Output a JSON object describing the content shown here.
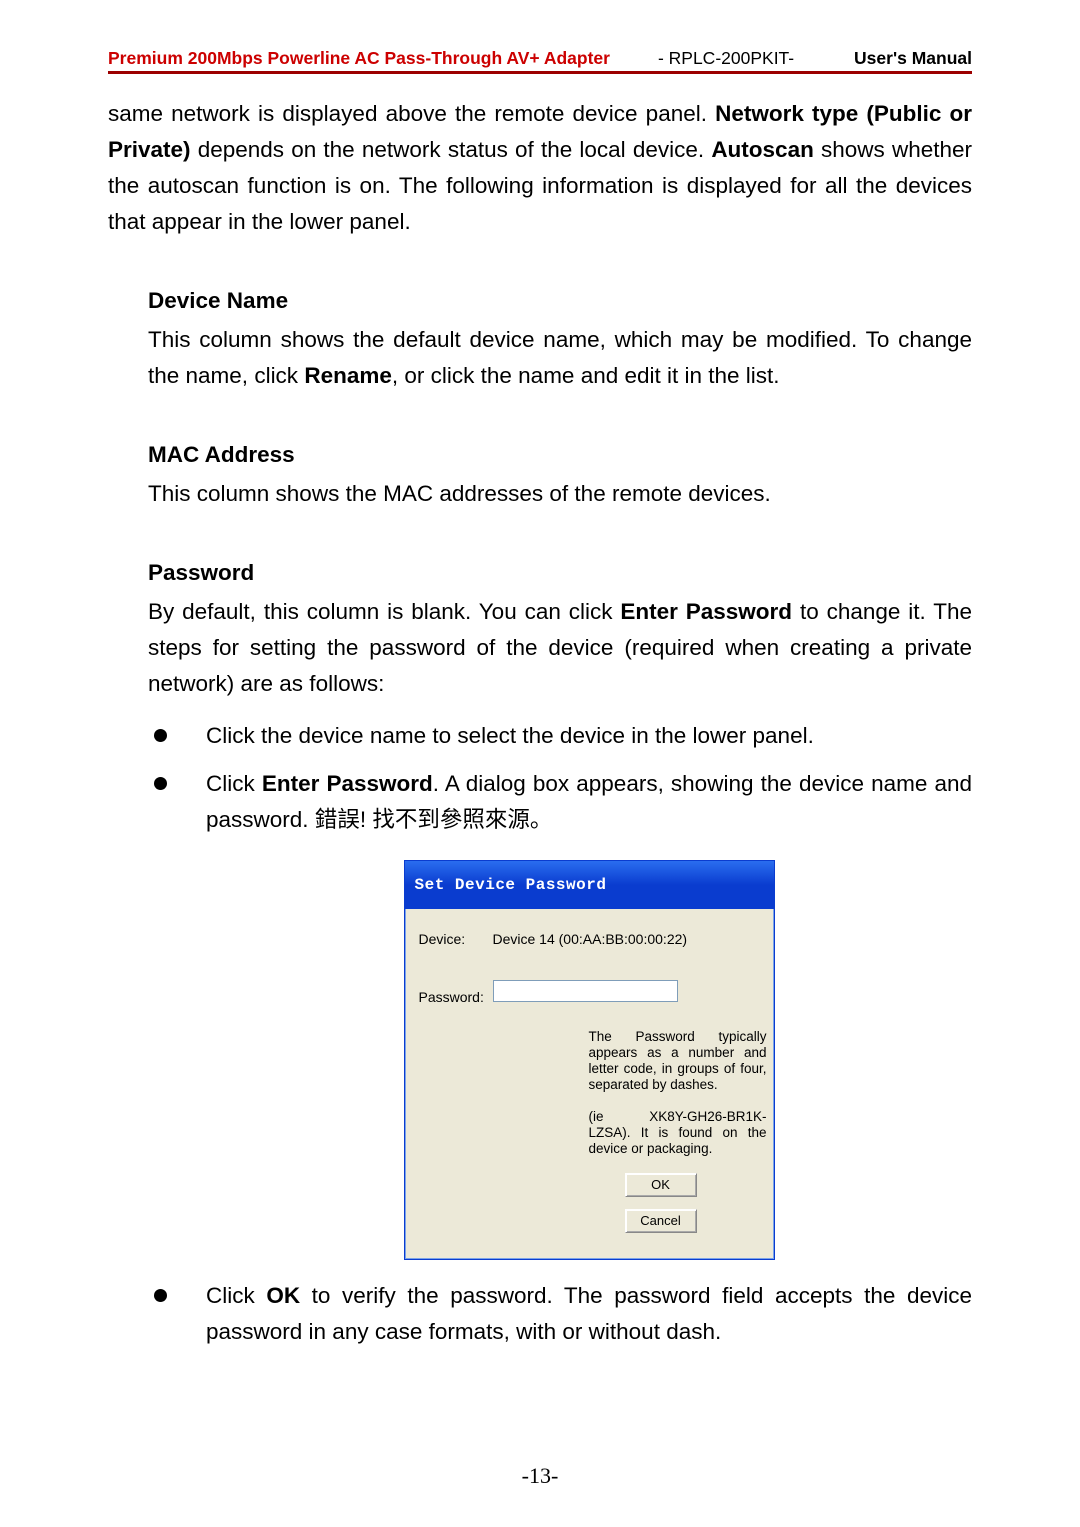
{
  "header": {
    "product": "Premium 200Mbps Powerline AC Pass-Through AV+ Adapter",
    "model_prefix": "- ",
    "model": "RPLC-200PKIT",
    "model_suffix": "-",
    "right": "User's Manual"
  },
  "para1": {
    "t1": "same network is displayed above the remote device panel. ",
    "b1": "Network type (Public or Private)",
    "t2": " depends on the network status of the local device. ",
    "b2": "Autoscan",
    "t3": " shows whether the autoscan function is on. The following information is displayed for all the devices that appear in the lower panel."
  },
  "sections": {
    "device_name": {
      "heading": "Device Name",
      "t1": "This column shows the default device name, which may be modified. To change the name, click ",
      "b1": "Rename",
      "t2": ", or click the name and edit it in the list."
    },
    "mac": {
      "heading": "MAC Address",
      "body": "This column shows the MAC addresses of the remote devices."
    },
    "password": {
      "heading": "Password",
      "t1": "By default, this column is blank. You can click ",
      "b1": "Enter Password",
      "t2": " to change it. The steps for setting the password of the device (required when creating a private network) are as follows:"
    }
  },
  "bullets": {
    "li1": "Click the device name to select the device in the lower panel.",
    "li2": {
      "t1": "Click ",
      "b1": "Enter Password",
      "t2": ". A dialog box appears, showing the device name and password. ",
      "cjk": "錯誤! 找不到參照來源。"
    },
    "li3": {
      "t1": "Click ",
      "b1": "OK",
      "t2": " to verify the password. The password field accepts the device password in any case formats, with or without dash."
    }
  },
  "dialog": {
    "title": "Set Device Password",
    "device_label": "Device:",
    "device_value": "Device 14  (00:AA:BB:00:00:22)",
    "password_label": "Password:",
    "password_value": "",
    "hint1": "The Password typically appears as a number and letter code, in groups of four, separated by dashes.",
    "hint2": "(ie XK8Y-GH26-BR1K-LZSA). It is found on the device or packaging.",
    "ok": "OK",
    "cancel": "Cancel"
  },
  "page_number": "-13-"
}
